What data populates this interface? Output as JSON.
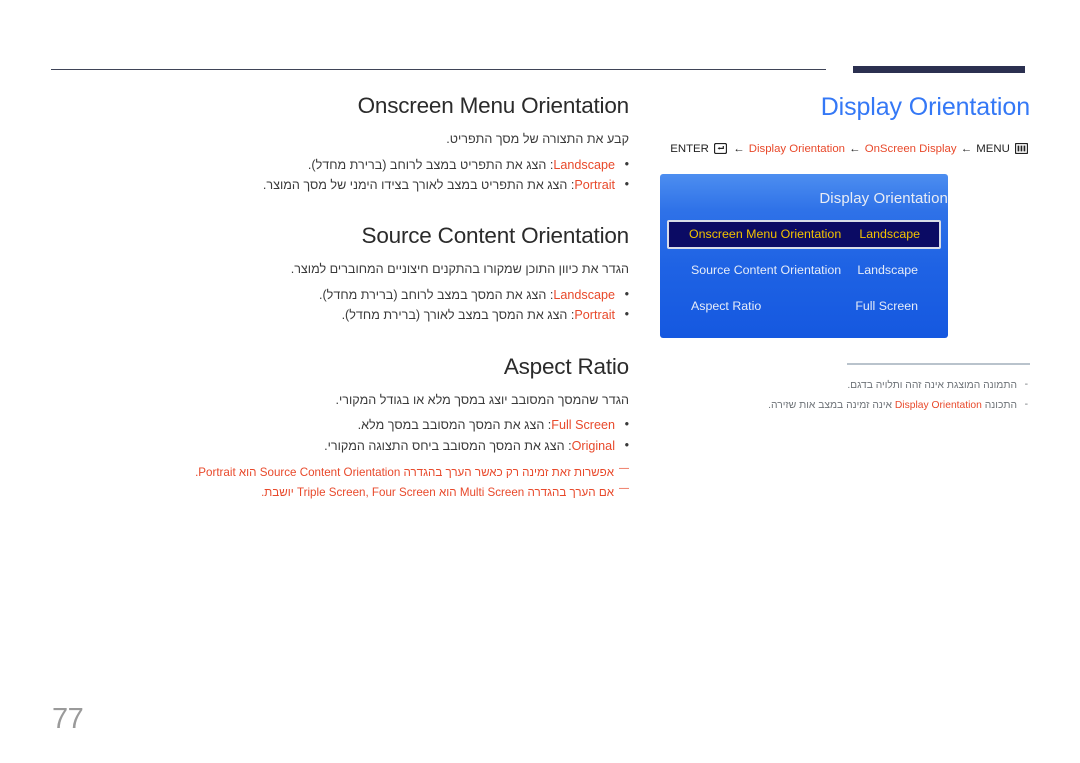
{
  "page": {
    "number": "77",
    "language": "he"
  },
  "colors": {
    "accent_orange": "#e8492b",
    "title_blue": "#3478f6",
    "rule_navy": "#2b3050",
    "osd_blue": "#1f63e4",
    "osd_selected_bg": "#0b0b64",
    "osd_selected_text": "#f2c200",
    "page_number_gray": "#9a9a9a"
  },
  "left_column": {
    "sections": [
      {
        "title": "Onscreen Menu Orientation",
        "intro": "קבע את התצורה של מסך התפריט.",
        "bullets": [
          {
            "keyword": "Landscape",
            "text": ": הצג את התפריט במצב לרוחב (ברירת מחדל)."
          },
          {
            "keyword": "Portrait",
            "text": ": הצג את התפריט במצב לאורך בצידו הימני של מסך המוצר."
          }
        ],
        "notes": []
      },
      {
        "title": "Source Content Orientation",
        "intro": "הגדר את כיוון התוכן שמקורו בהתקנים חיצוניים המחוברים למוצר.",
        "bullets": [
          {
            "keyword": "Landscape",
            "text": ": הצג את המסך במצב לרוחב (ברירת מחדל)."
          },
          {
            "keyword": "Portrait",
            "text": ": הצג את המסך במצב לאורך (ברירת מחדל)."
          }
        ],
        "notes": []
      },
      {
        "title": "Aspect Ratio",
        "intro": "הגדר שהמסך המסובב יוצג במסך מלא או בגודל המקורי.",
        "bullets": [
          {
            "keyword": "Full Screen",
            "text": ": הצג את המסך המסובב במסך מלא."
          },
          {
            "keyword": "Original",
            "text": ": הצג את המסך המסובב ביחס התצוגה המקורי."
          }
        ],
        "notes": [
          "אפשרות זאת זמינה רק כאשר הערך בהגדרה Source Content Orientation הוא Portrait.",
          "אם הערך בהגדרה Multi Screen הוא Triple Screen, Four Screen יושבת."
        ]
      }
    ]
  },
  "right_column": {
    "page_title": "Display Orientation",
    "breadcrumb": {
      "enter_label": "ENTER",
      "enter_icon": "enter-key-icon",
      "menu_label": "MENU",
      "menu_icon": "menu-grid-icon",
      "arrow": "←",
      "path": [
        "Display Orientation",
        "OnScreen Display"
      ]
    },
    "osd": {
      "title": "Display Orientation",
      "rows": [
        {
          "label": "Onscreen Menu Orientation",
          "value": "Landscape",
          "selected": true
        },
        {
          "label": "Source Content Orientation",
          "value": "Landscape",
          "selected": false
        },
        {
          "label": "Aspect Ratio",
          "value": "Full Screen",
          "selected": false
        }
      ]
    },
    "notes": [
      {
        "text": "התמונה המוצגת אינה זהה ותלויה בדגם.",
        "keyword": "",
        "pre": "",
        "post": ""
      },
      {
        "text": "התכונה Display Orientation אינה זמינה במצב אות שזירה.",
        "keyword": "Display Orientation",
        "pre": "התכונה ",
        "post": " אינה זמינה במצב אות שזירה."
      }
    ]
  }
}
